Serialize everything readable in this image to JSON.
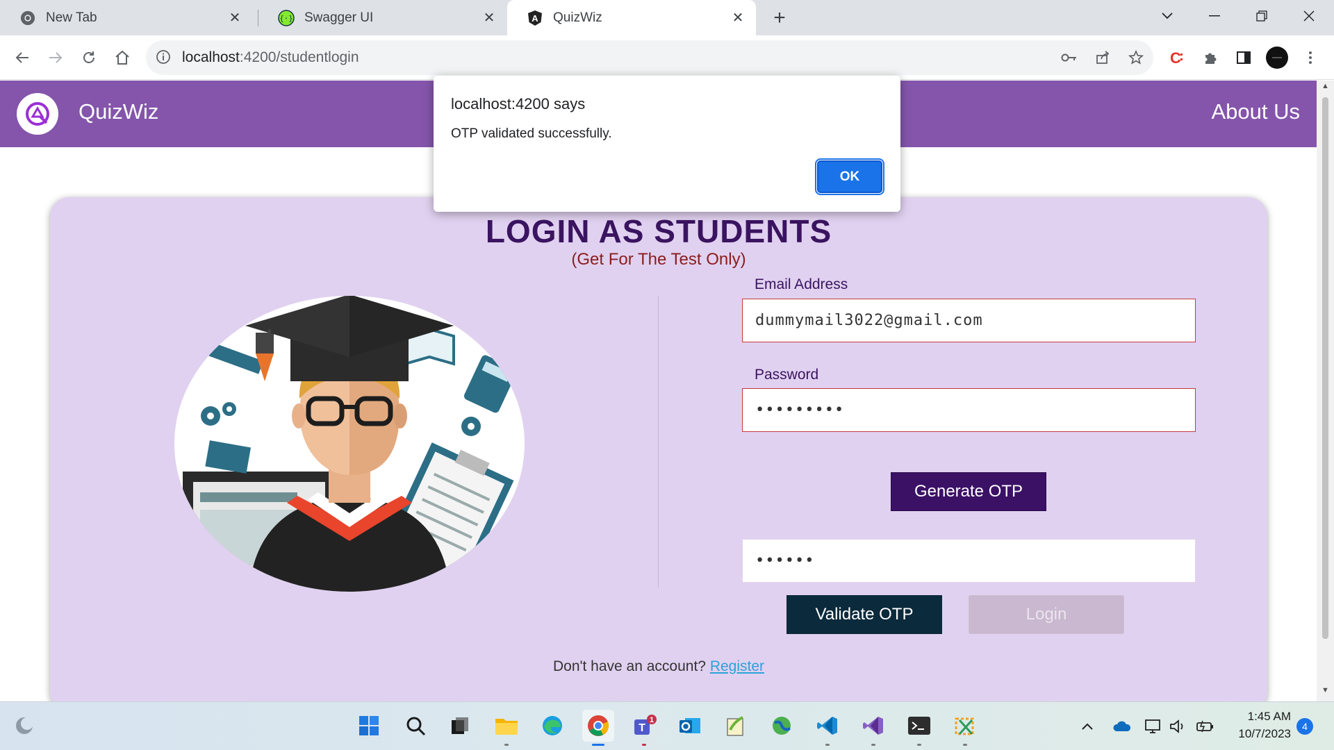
{
  "browser": {
    "tabs": [
      {
        "label": "New Tab",
        "icon": "chrome-icon"
      },
      {
        "label": "Swagger UI",
        "icon": "swagger-icon"
      },
      {
        "label": "QuizWiz",
        "icon": "angular-icon",
        "active": true
      }
    ],
    "address": {
      "host": "localhost",
      "rest": ":4200/studentlogin"
    }
  },
  "navbar": {
    "brand": "QuizWiz",
    "about": "About Us",
    "bg_color": "#8455ab"
  },
  "login": {
    "title": "LOGIN AS STUDENTS",
    "subtitle": "(Get For The Test Only)",
    "email_label": "Email Address",
    "email_value": "dummymail3022@gmail.com",
    "password_label": "Password",
    "password_value": "•••••••••",
    "generate_otp": "Generate OTP",
    "otp_value": "••••••",
    "validate_otp": "Validate OTP",
    "login": "Login",
    "no_account": "Don't have an account?",
    "register": "Register"
  },
  "dialog": {
    "title": "localhost:4200 says",
    "message": "OTP validated successfully.",
    "ok": "OK"
  },
  "taskbar": {
    "time": "1:45 AM",
    "date": "10/7/2023",
    "notifications": "4",
    "teams_badge": "1"
  },
  "colors": {
    "accent": "#8455ab",
    "card": "#e1d1f0",
    "dark_button": "#3b1166",
    "validate_button": "#0b2a3b"
  }
}
